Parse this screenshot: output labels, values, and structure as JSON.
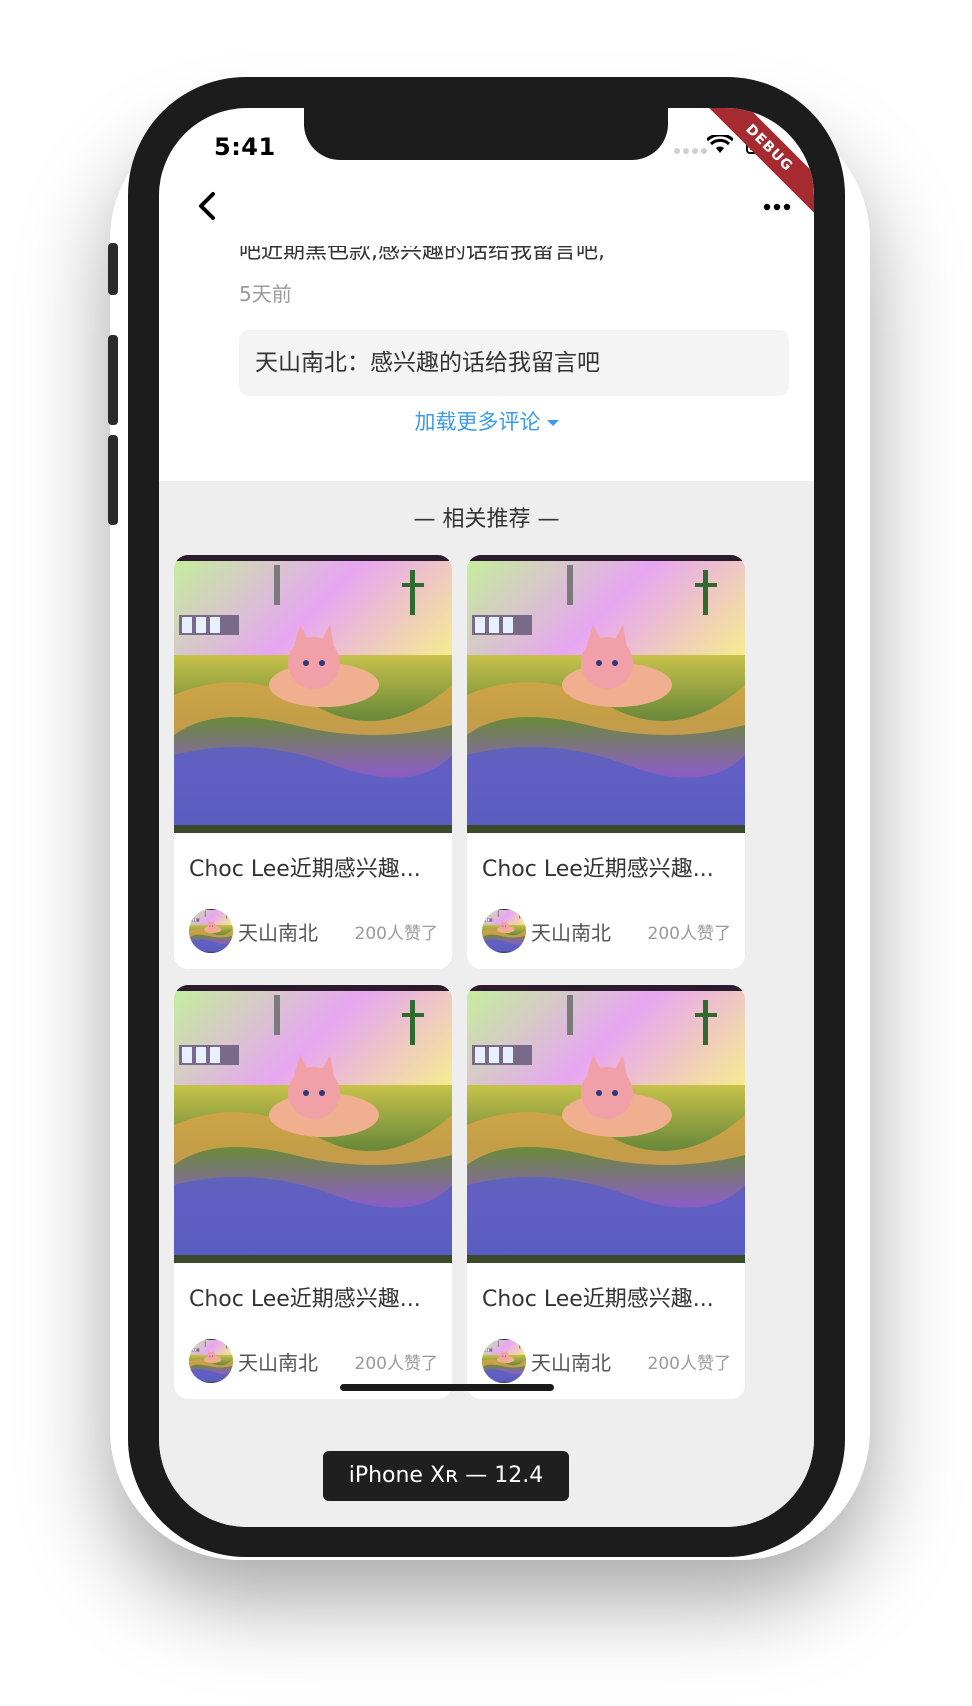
{
  "status_bar": {
    "time": "5:41",
    "debug_label": "DEBUG"
  },
  "nav": {
    "back_icon": "chevron-left-icon",
    "more_icon": "more-dots-icon"
  },
  "comment": {
    "text": "吧近期黑色款,感兴趣的话给我留言吧,",
    "date": "5天前",
    "reply": "天山南北：感兴趣的话给我留言吧",
    "load_more": "加载更多评论"
  },
  "recommend": {
    "title": "— 相关推荐 —",
    "cards": [
      {
        "title": "Choc Lee近期感兴趣...",
        "author": "天山南北",
        "likes": "200人赞了"
      },
      {
        "title": "Choc Lee近期感兴趣...",
        "author": "天山南北",
        "likes": "200人赞了"
      },
      {
        "title": "Choc Lee近期感兴趣...",
        "author": "天山南北",
        "likes": "200人赞了"
      },
      {
        "title": "Choc Lee近期感兴趣...",
        "author": "天山南北",
        "likes": "200人赞了"
      }
    ]
  },
  "device_label": "iPhone Xʀ — 12.4",
  "colors": {
    "link": "#3b9be8",
    "recommend_bg": "#eeeeee",
    "debug_ribbon": "#a62b30"
  }
}
